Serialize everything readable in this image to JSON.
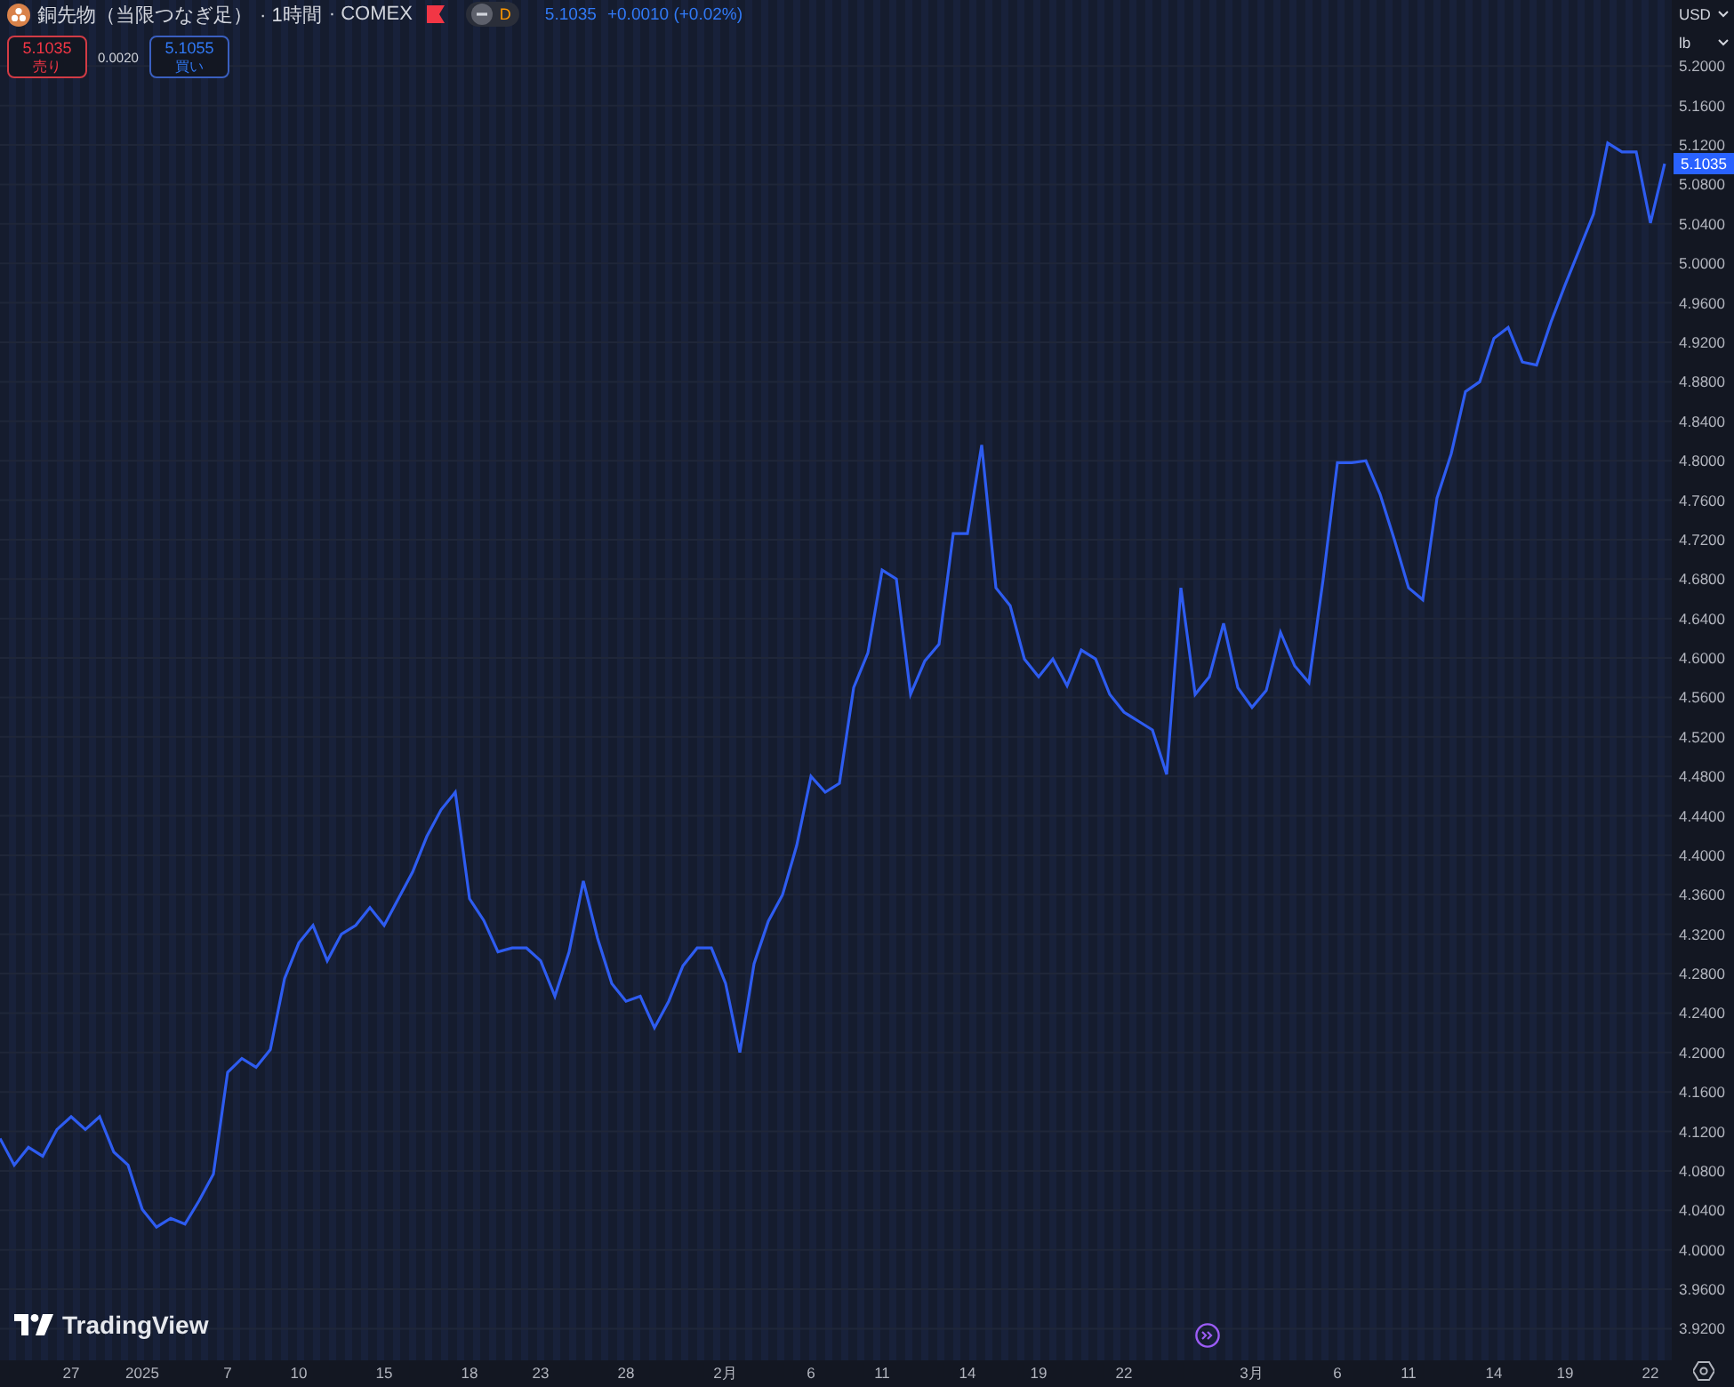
{
  "header": {
    "title": "銅先物（当限つなぎ足）",
    "interval": "· 1時間",
    "exchange": "· COMEX",
    "badge": "D",
    "price": "5.1035",
    "change": "+0.0010 (+0.02%)"
  },
  "trade": {
    "sell_price": "5.1035",
    "sell_label": "売り",
    "spread": "0.0020",
    "buy_price": "5.1055",
    "buy_label": "買い"
  },
  "axis_controls": [
    {
      "label": "USD"
    },
    {
      "label": "lb"
    }
  ],
  "price_label": "5.1035",
  "logo": "TradingView",
  "chart_data": {
    "type": "line",
    "grid": true,
    "ylim": [
      3.888,
      5.267
    ],
    "categories": [
      null,
      null,
      null,
      null,
      null,
      "27",
      null,
      null,
      null,
      null,
      "2025",
      null,
      null,
      null,
      null,
      null,
      "7",
      null,
      null,
      null,
      null,
      "10",
      null,
      null,
      null,
      null,
      null,
      "15",
      null,
      null,
      null,
      null,
      null,
      "18",
      null,
      null,
      null,
      null,
      "23",
      null,
      null,
      null,
      null,
      null,
      "28",
      null,
      null,
      null,
      null,
      null,
      null,
      "2月",
      null,
      null,
      null,
      null,
      null,
      "6",
      null,
      null,
      null,
      null,
      "11",
      null,
      null,
      null,
      null,
      null,
      "14",
      null,
      null,
      null,
      null,
      "19",
      null,
      null,
      null,
      null,
      null,
      "22",
      null,
      null,
      null,
      null,
      null,
      null,
      null,
      null,
      "3月",
      null,
      null,
      null,
      null,
      null,
      "6",
      null,
      null,
      null,
      null,
      "11",
      null,
      null,
      null,
      null,
      null,
      "14",
      null,
      null,
      null,
      null,
      "19",
      null,
      null,
      null,
      null,
      null,
      "22",
      null
    ],
    "series": [
      {
        "color": "#2e5cf0",
        "values": [
          4.113,
          4.086,
          4.104,
          4.095,
          4.122,
          4.135,
          4.122,
          4.135,
          4.099,
          4.086,
          4.041,
          4.023,
          4.032,
          4.026,
          4.05,
          4.077,
          4.18,
          4.194,
          4.185,
          4.203,
          4.275,
          4.311,
          4.329,
          4.293,
          4.32,
          4.329,
          4.347,
          4.329,
          4.356,
          4.383,
          4.419,
          4.446,
          4.464,
          4.356,
          4.334,
          4.302,
          4.306,
          4.306,
          4.293,
          4.257,
          4.302,
          4.374,
          4.316,
          4.27,
          4.252,
          4.257,
          4.225,
          4.252,
          4.288,
          4.306,
          4.306,
          4.27,
          4.2,
          4.29,
          4.333,
          4.36,
          4.41,
          4.48,
          4.464,
          4.473,
          4.57,
          4.605,
          4.689,
          4.68,
          4.563,
          4.597,
          4.614,
          4.726,
          4.726,
          4.816,
          4.671,
          4.653,
          4.599,
          4.581,
          4.599,
          4.572,
          4.608,
          4.599,
          4.563,
          4.545,
          4.536,
          4.527,
          4.482,
          4.671,
          4.563,
          4.581,
          4.635,
          4.57,
          4.55,
          4.567,
          4.626,
          4.592,
          4.575,
          4.68,
          4.798,
          4.798,
          4.8,
          4.766,
          4.72,
          4.671,
          4.659,
          4.762,
          4.807,
          4.87,
          4.88,
          4.924,
          4.935,
          4.9,
          4.897,
          4.94,
          4.978,
          5.014,
          5.05,
          5.122,
          5.113,
          5.113,
          5.041,
          5.101
        ]
      }
    ],
    "yticks": [
      {
        "value": 5.2,
        "label": "5.2000"
      },
      {
        "value": 5.16,
        "label": "5.1600"
      },
      {
        "value": 5.12,
        "label": "5.1200"
      },
      {
        "value": 5.08,
        "label": "5.0800"
      },
      {
        "value": 5.04,
        "label": "5.0400"
      },
      {
        "value": 5.0,
        "label": "5.0000"
      },
      {
        "value": 4.96,
        "label": "4.9600"
      },
      {
        "value": 4.92,
        "label": "4.9200"
      },
      {
        "value": 4.88,
        "label": "4.8800"
      },
      {
        "value": 4.84,
        "label": "4.8400"
      },
      {
        "value": 4.8,
        "label": "4.8000"
      },
      {
        "value": 4.76,
        "label": "4.7600"
      },
      {
        "value": 4.72,
        "label": "4.7200"
      },
      {
        "value": 4.68,
        "label": "4.6800"
      },
      {
        "value": 4.64,
        "label": "4.6400"
      },
      {
        "value": 4.6,
        "label": "4.6000"
      },
      {
        "value": 4.56,
        "label": "4.5600"
      },
      {
        "value": 4.52,
        "label": "4.5200"
      },
      {
        "value": 4.48,
        "label": "4.4800"
      },
      {
        "value": 4.44,
        "label": "4.4400"
      },
      {
        "value": 4.4,
        "label": "4.4000"
      },
      {
        "value": 4.36,
        "label": "4.3600"
      },
      {
        "value": 4.32,
        "label": "4.3200"
      },
      {
        "value": 4.28,
        "label": "4.2800"
      },
      {
        "value": 4.24,
        "label": "4.2400"
      },
      {
        "value": 4.2,
        "label": "4.2000"
      },
      {
        "value": 4.16,
        "label": "4.1600"
      },
      {
        "value": 4.12,
        "label": "4.1200"
      },
      {
        "value": 4.08,
        "label": "4.0800"
      },
      {
        "value": 4.04,
        "label": "4.0400"
      },
      {
        "value": 4.0,
        "label": "4.0000"
      },
      {
        "value": 3.96,
        "label": "3.9600"
      },
      {
        "value": 3.92,
        "label": "3.9200"
      }
    ]
  }
}
